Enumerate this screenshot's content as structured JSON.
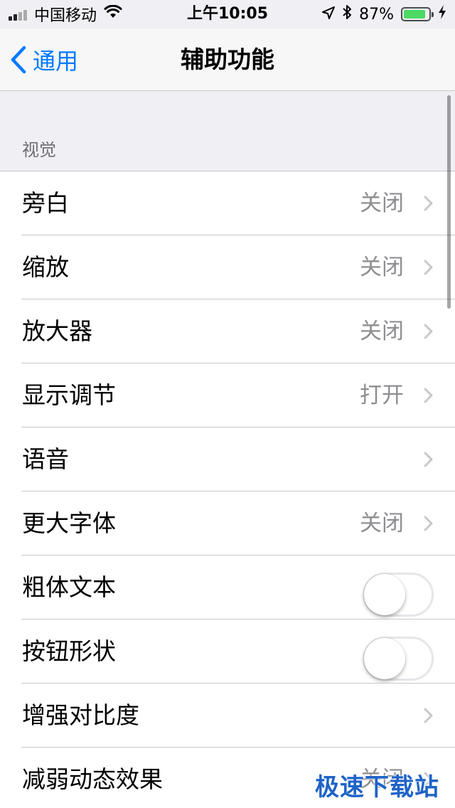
{
  "status_bar": {
    "carrier": "中国移动",
    "time": "上午10:05",
    "battery_percent": "87%",
    "battery_level": 0.87,
    "icons": [
      "signal-icon",
      "wifi-icon",
      "location-icon",
      "bluetooth-icon",
      "battery-icon",
      "charging-icon"
    ]
  },
  "nav": {
    "back_label": "通用",
    "title": "辅助功能"
  },
  "section": {
    "header": "视觉"
  },
  "rows": [
    {
      "label": "旁白",
      "value": "关闭",
      "accessory": "chevron"
    },
    {
      "label": "缩放",
      "value": "关闭",
      "accessory": "chevron"
    },
    {
      "label": "放大器",
      "value": "关闭",
      "accessory": "chevron"
    },
    {
      "label": "显示调节",
      "value": "打开",
      "accessory": "chevron"
    },
    {
      "label": "语音",
      "value": "",
      "accessory": "chevron"
    },
    {
      "label": "更大字体",
      "value": "关闭",
      "accessory": "chevron"
    },
    {
      "label": "粗体文本",
      "accessory": "toggle",
      "on": false
    },
    {
      "label": "按钮形状",
      "accessory": "toggle",
      "on": false
    },
    {
      "label": "增强对比度",
      "value": "",
      "accessory": "chevron"
    },
    {
      "label": "减弱动态效果",
      "value": "关闭",
      "accessory": "chevron"
    }
  ],
  "watermark": "极速下载站",
  "colors": {
    "accent": "#007aff",
    "battery_green": "#4cd964",
    "secondary_text": "#8e8e93",
    "background": "#efeff4",
    "watermark": "#1e63c8"
  }
}
